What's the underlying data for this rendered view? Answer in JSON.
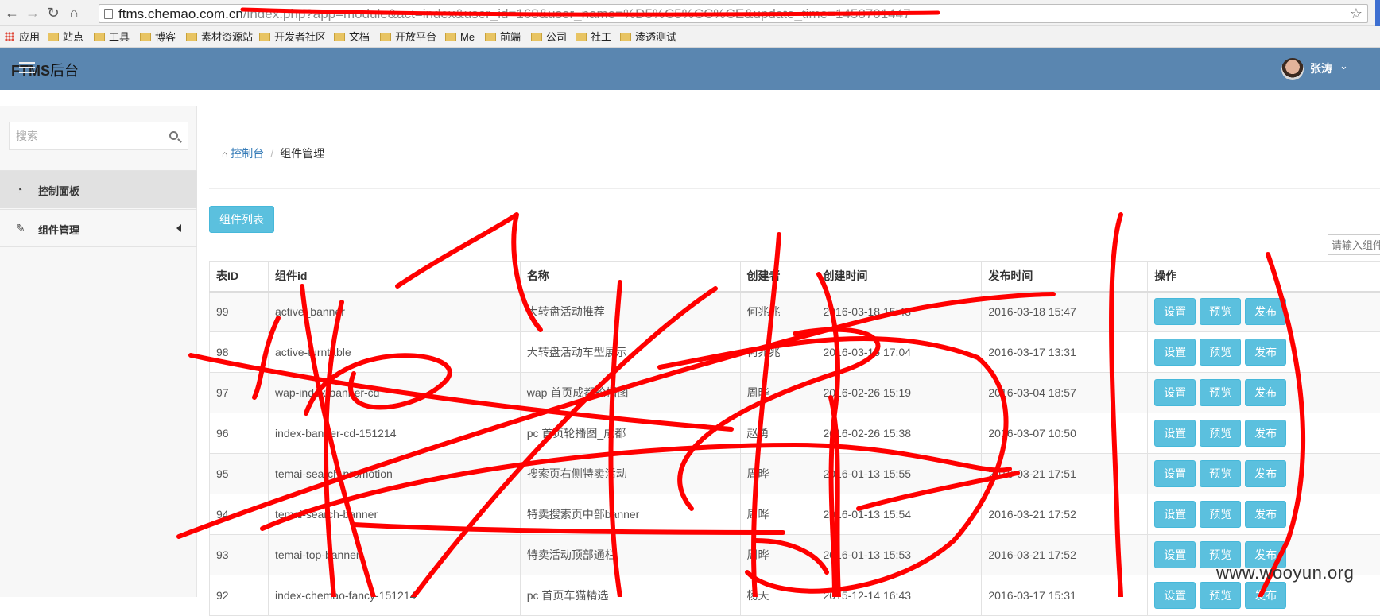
{
  "browser": {
    "url_host": "ftms.chemao.com.cn",
    "url_path": "/index.php?app=module&act=index&user_id=168&user_name=%D5%C5%CC%CE&update_time=1458701447",
    "bookmarks": [
      "应用",
      "站点",
      "工具",
      "博客",
      "素材资源站",
      "开发者社区",
      "文档",
      "开放平台",
      "Me",
      "前端",
      "公司",
      "社工",
      "渗透测试"
    ]
  },
  "header": {
    "brand_bold": "FTMS",
    "brand_rest": "后台",
    "user_name": "张涛"
  },
  "sidebar": {
    "search_placeholder": "搜索",
    "items": [
      {
        "label": "控制面板",
        "icon": "dashboard-icon"
      },
      {
        "label": "组件管理",
        "icon": "edit-icon"
      }
    ]
  },
  "breadcrumb": {
    "home": "控制台",
    "separator": "/",
    "current": "组件管理"
  },
  "toolbar": {
    "list_button": "组件列表",
    "filter_placeholder": "请输入组件"
  },
  "table": {
    "headers": [
      "表ID",
      "组件id",
      "名称",
      "创建者",
      "创建时间",
      "发布时间",
      "操作"
    ],
    "actions": [
      "设置",
      "预览",
      "发布"
    ],
    "rows": [
      {
        "id": "99",
        "component": "active_banner",
        "name": "大转盘活动推荐",
        "creator": "何兆兆",
        "created": "2016-03-18 15:48",
        "published": "2016-03-18 15:47"
      },
      {
        "id": "98",
        "component": "active-turntable",
        "name": "大转盘活动车型展示",
        "creator": "何兆兆",
        "created": "2016-03-15 17:04",
        "published": "2016-03-17 13:31"
      },
      {
        "id": "97",
        "component": "wap-index-banner-cd",
        "name": "wap 首页成都轮播图",
        "creator": "周晔",
        "created": "2016-02-26 15:19",
        "published": "2016-03-04 18:57"
      },
      {
        "id": "96",
        "component": "index-banner-cd-151214",
        "name": "pc 首页轮播图_成都",
        "creator": "赵勇",
        "created": "2016-02-26 15:38",
        "published": "2016-03-07 10:50"
      },
      {
        "id": "95",
        "component": "temai-search-promotion",
        "name": "搜索页右侧特卖活动",
        "creator": "周晔",
        "created": "2016-01-13 15:55",
        "published": "2016-03-21 17:51"
      },
      {
        "id": "94",
        "component": "temai-search-banner",
        "name": "特卖搜索页中部banner",
        "creator": "周晔",
        "created": "2016-01-13 15:54",
        "published": "2016-03-21 17:52"
      },
      {
        "id": "93",
        "component": "temai-top-banner",
        "name": "特卖活动顶部通栏",
        "creator": "周晔",
        "created": "2016-01-13 15:53",
        "published": "2016-03-21 17:52"
      },
      {
        "id": "92",
        "component": "index-chemao-fancy-151214",
        "name": "pc 首页车猫精选",
        "creator": "杨天",
        "created": "2015-12-14 16:43",
        "published": "2016-03-17 15:31"
      }
    ]
  },
  "watermark": "www.wooyun.org",
  "colors": {
    "header_bg": "#5a86b0",
    "info_button": "#5bc0de",
    "link": "#337ab7",
    "scribble": "#ff0000"
  }
}
